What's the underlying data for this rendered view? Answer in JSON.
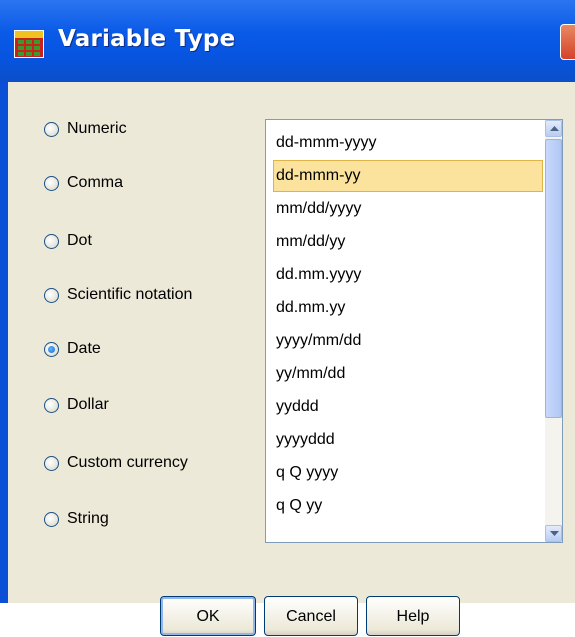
{
  "window": {
    "title": "Variable Type",
    "icon": "spss-grid-icon"
  },
  "types": [
    {
      "label": "Numeric",
      "mnemonic": "N",
      "checked": false
    },
    {
      "label": "Comma",
      "mnemonic": "C",
      "checked": false
    },
    {
      "label": "Dot",
      "mnemonic": "D",
      "checked": false
    },
    {
      "label": "Scientific notation",
      "mnemonic": "S",
      "checked": false
    },
    {
      "label": "Date",
      "mnemonic": "a",
      "checked": true
    },
    {
      "label": "Dollar",
      "mnemonic": "l",
      "checked": false
    },
    {
      "label": "Custom currency",
      "mnemonic": "u",
      "checked": false
    },
    {
      "label": "String",
      "mnemonic": "r",
      "checked": false
    }
  ],
  "date_formats": [
    "dd-mmm-yyyy",
    "dd-mmm-yy",
    "mm/dd/yyyy",
    "mm/dd/yy",
    "dd.mm.yyyy",
    "dd.mm.yy",
    "yyyy/mm/dd",
    "yy/mm/dd",
    "yyddd",
    "yyyyddd",
    "q Q yyyy",
    "q Q yy"
  ],
  "selected_format": "dd-mmm-yy",
  "buttons": {
    "ok": "OK",
    "cancel": "Cancel",
    "help": "Help"
  },
  "colors": {
    "titlebar": "#0754e0",
    "selection": "#fbe39d",
    "face": "#ece9d8"
  }
}
